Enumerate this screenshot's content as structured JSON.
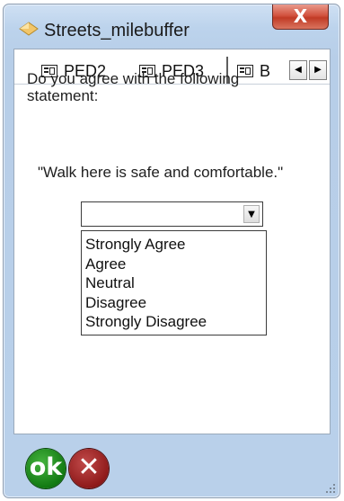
{
  "window": {
    "title": "Streets_milebuffer",
    "close_glyph": "X"
  },
  "tabs": [
    {
      "label": "PED2",
      "icon": "form-icon"
    },
    {
      "label": "PED3",
      "icon": "form-icon",
      "active": true
    },
    {
      "label": "B",
      "icon": "form-icon"
    }
  ],
  "tab_scroll": {
    "left_glyph": "◀",
    "right_glyph": "▶"
  },
  "question": {
    "text": "Do you agree with the following statement:",
    "statement": "\"Walk here is safe and comfortable.\""
  },
  "combo": {
    "value": "",
    "arrow_glyph": "▼",
    "options": [
      "Strongly Agree",
      "Agree",
      "Neutral",
      "Disagree",
      "Strongly Disagree"
    ]
  },
  "footer": {
    "ok_label": "ok",
    "cancel_glyph": "✕"
  },
  "colors": {
    "ok_green": "#1a8a1a",
    "cancel_red": "#9a1f1f",
    "close_red": "#c94430"
  }
}
